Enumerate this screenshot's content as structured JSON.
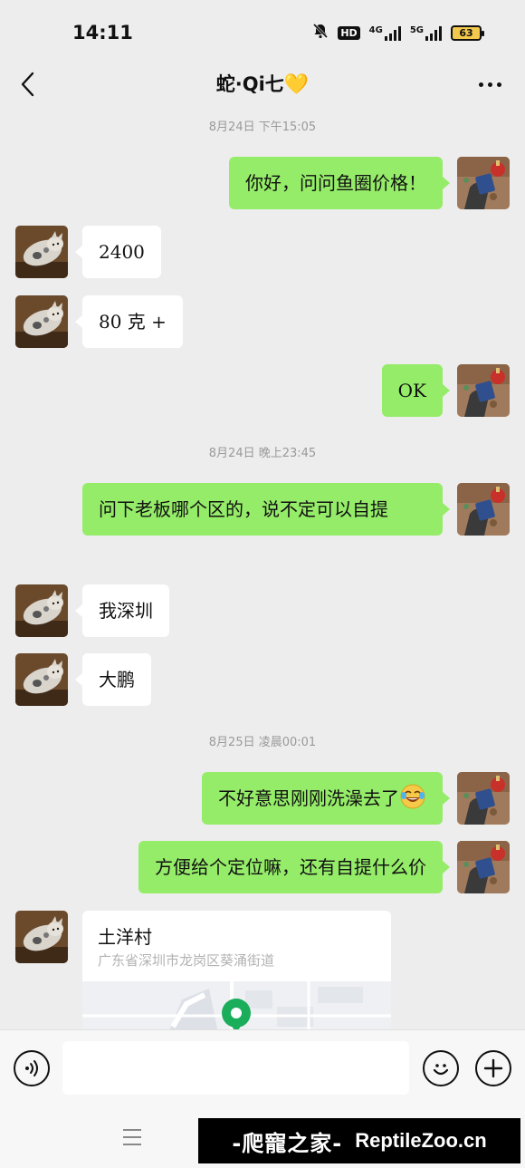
{
  "status_bar": {
    "time": "14:11",
    "hd_label": "HD",
    "network_4g": "4G",
    "network_5g": "5G",
    "battery_level": "63"
  },
  "header": {
    "title": "蛇·Qi七",
    "title_emoji": "💛"
  },
  "messages": [
    {
      "type": "time",
      "text": "8月24日  下午15:05"
    },
    {
      "type": "text",
      "side": "right",
      "text": "你好，问问鱼圈价格！"
    },
    {
      "type": "text",
      "side": "left",
      "text": "2400"
    },
    {
      "type": "text",
      "side": "left",
      "text": "80 克 +"
    },
    {
      "type": "text",
      "side": "right",
      "text": "OK"
    },
    {
      "type": "time",
      "text": "8月24日  晚上23:45"
    },
    {
      "type": "text",
      "side": "right",
      "text": "问下老板哪个区的，说不定可以自提"
    },
    {
      "type": "text",
      "side": "left",
      "text": "我深圳"
    },
    {
      "type": "text",
      "side": "left",
      "text": "大鹏"
    },
    {
      "type": "time",
      "text": "8月25日  凌晨00:01"
    },
    {
      "type": "text",
      "side": "right",
      "text": "不好意思刚刚洗澡去了",
      "emoji": "face-with-tears-of-joy-icon"
    },
    {
      "type": "text",
      "side": "right",
      "text": "方便给个定位嘛，还有自提什么价"
    },
    {
      "type": "location",
      "side": "left",
      "title": "土洋村",
      "address": "广东省深圳市龙岗区葵涌街道"
    }
  ],
  "input_bar": {
    "placeholder": ""
  },
  "watermark": {
    "cn": "-爬寵之家-",
    "en": "ReptileZoo.cn"
  },
  "colors": {
    "outgoing_bubble": "#95ec69",
    "incoming_bubble": "#ffffff",
    "background": "#ededed"
  }
}
